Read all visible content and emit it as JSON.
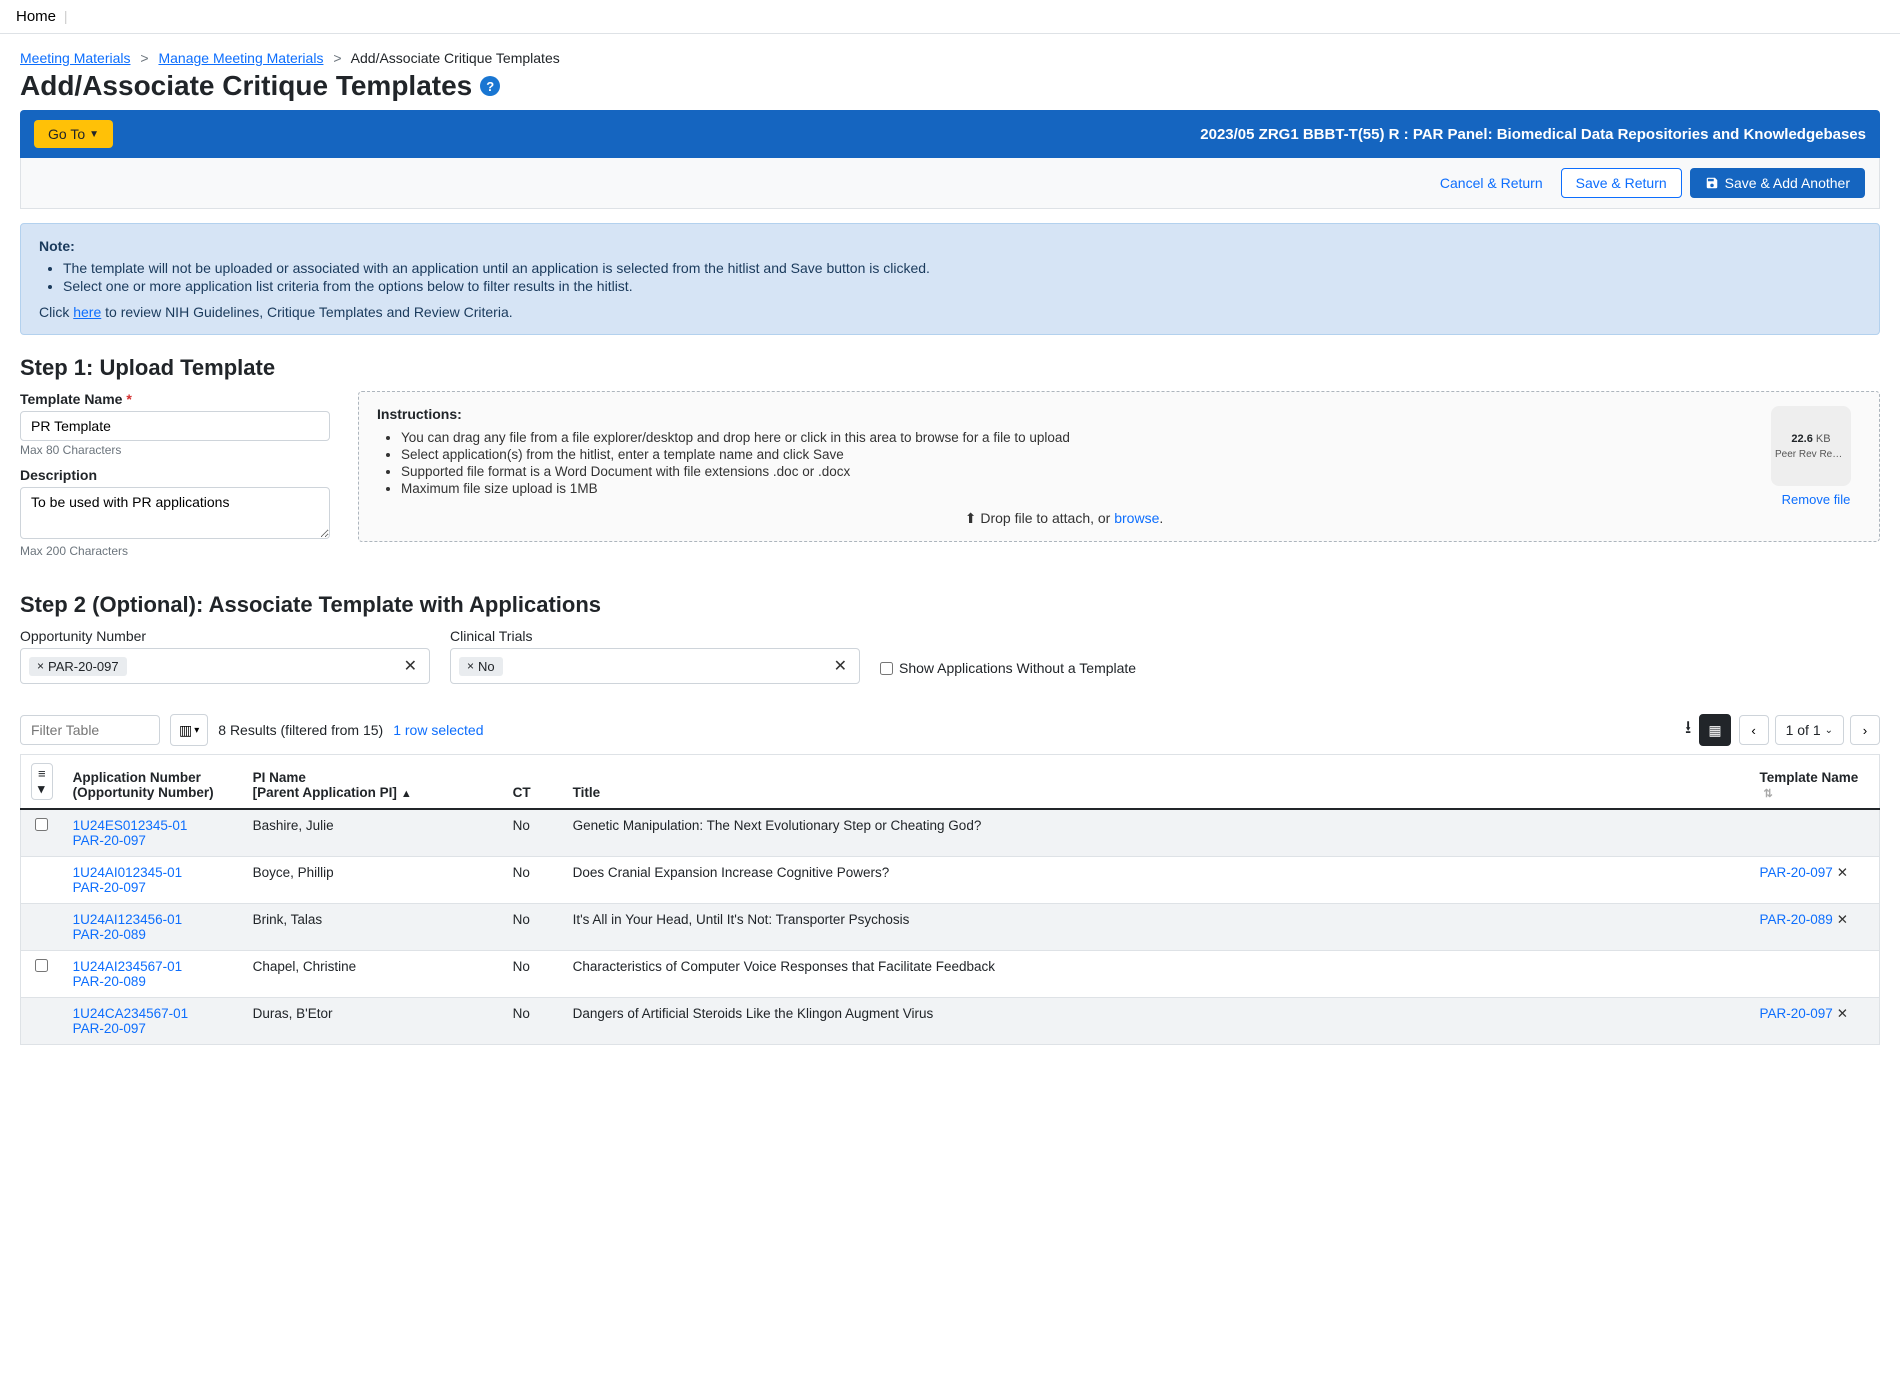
{
  "topnav": {
    "home": "Home"
  },
  "breadcrumb": {
    "items": [
      "Meeting Materials",
      "Manage Meeting Materials"
    ],
    "current": "Add/Associate Critique Templates"
  },
  "page": {
    "title": "Add/Associate Critique Templates"
  },
  "bluebar": {
    "goto": "Go To",
    "title": "2023/05 ZRG1 BBBT-T(55) R : PAR Panel: Biomedical Data Repositories and Knowledgebases"
  },
  "actions": {
    "cancel": "Cancel & Return",
    "save": "Save & Return",
    "saveadd": "Save & Add Another"
  },
  "note": {
    "title": "Note:",
    "bullets": [
      "The template will not be uploaded or associated with an application until an application is selected from the hitlist and Save button is clicked.",
      "Select one or more application list criteria from the options below to filter results in the hitlist."
    ],
    "footer_pre": "Click ",
    "footer_link": "here",
    "footer_post": " to review NIH Guidelines, Critique Templates and Review Criteria."
  },
  "step1": {
    "heading": "Step 1: Upload Template",
    "name_label": "Template Name",
    "name_value": "PR Template",
    "name_hint": "Max 80 Characters",
    "desc_label": "Description",
    "desc_value": "To be used with PR applications",
    "desc_hint": "Max 200 Characters",
    "instr_title": "Instructions:",
    "instr_items": [
      "You can drag any file from a file explorer/desktop and drop here or click in this area to browse for a file to upload",
      "Select application(s) from the hitlist, enter a template name and click Save",
      "Supported file format is a Word Document with file extensions .doc or .docx",
      "Maximum file size upload is 1MB"
    ],
    "drop_pre": "Drop file to attach, or ",
    "drop_link": "browse",
    "file": {
      "size": "22.6",
      "unit": "KB",
      "name": "Peer Rev Revi...",
      "remove": "Remove file"
    }
  },
  "step2": {
    "heading": "Step 2 (Optional): Associate Template with Applications",
    "opp_label": "Opportunity Number",
    "opp_chip": "PAR-20-097",
    "ct_label": "Clinical Trials",
    "ct_chip": "No",
    "show_without": "Show Applications Without a Template"
  },
  "table": {
    "filter_placeholder": "Filter Table",
    "results": "8 Results (filtered from 15)",
    "selected": "1 row selected",
    "page_info": "1 of 1",
    "headers": {
      "app": "Application Number",
      "opp": "(Opportunity Number)",
      "pi": "PI Name",
      "pi2": "[Parent Application PI]",
      "ct": "CT",
      "title": "Title",
      "tmpl": "Template Name"
    },
    "rows": [
      {
        "app": "1U24ES012345-01",
        "opp": "PAR-20-097",
        "pi": "Bashire, Julie",
        "ct": "No",
        "title": "Genetic Manipulation: The Next Evolutionary Step or Cheating God?",
        "tmpl": "",
        "checkbox": true
      },
      {
        "app": "1U24AI012345-01",
        "opp": "PAR-20-097",
        "pi": "Boyce, Phillip",
        "ct": "No",
        "title": "Does Cranial Expansion Increase Cognitive Powers?",
        "tmpl": "PAR-20-097",
        "checkbox": false
      },
      {
        "app": "1U24AI123456-01",
        "opp": "PAR-20-089",
        "pi": "Brink, Talas",
        "ct": "No",
        "title": "It's All in Your Head, Until It's Not: Transporter Psychosis",
        "tmpl": "PAR-20-089",
        "checkbox": false
      },
      {
        "app": "1U24AI234567-01",
        "opp": "PAR-20-089",
        "pi": "Chapel, Christine",
        "ct": "No",
        "title": "Characteristics of Computer Voice Responses that Facilitate Feedback",
        "tmpl": "",
        "checkbox": true
      },
      {
        "app": "1U24CA234567-01",
        "opp": "PAR-20-097",
        "pi": "Duras, B'Etor",
        "ct": "No",
        "title": "Dangers of Artificial Steroids Like the Klingon Augment Virus",
        "tmpl": "PAR-20-097",
        "checkbox": false
      }
    ]
  }
}
